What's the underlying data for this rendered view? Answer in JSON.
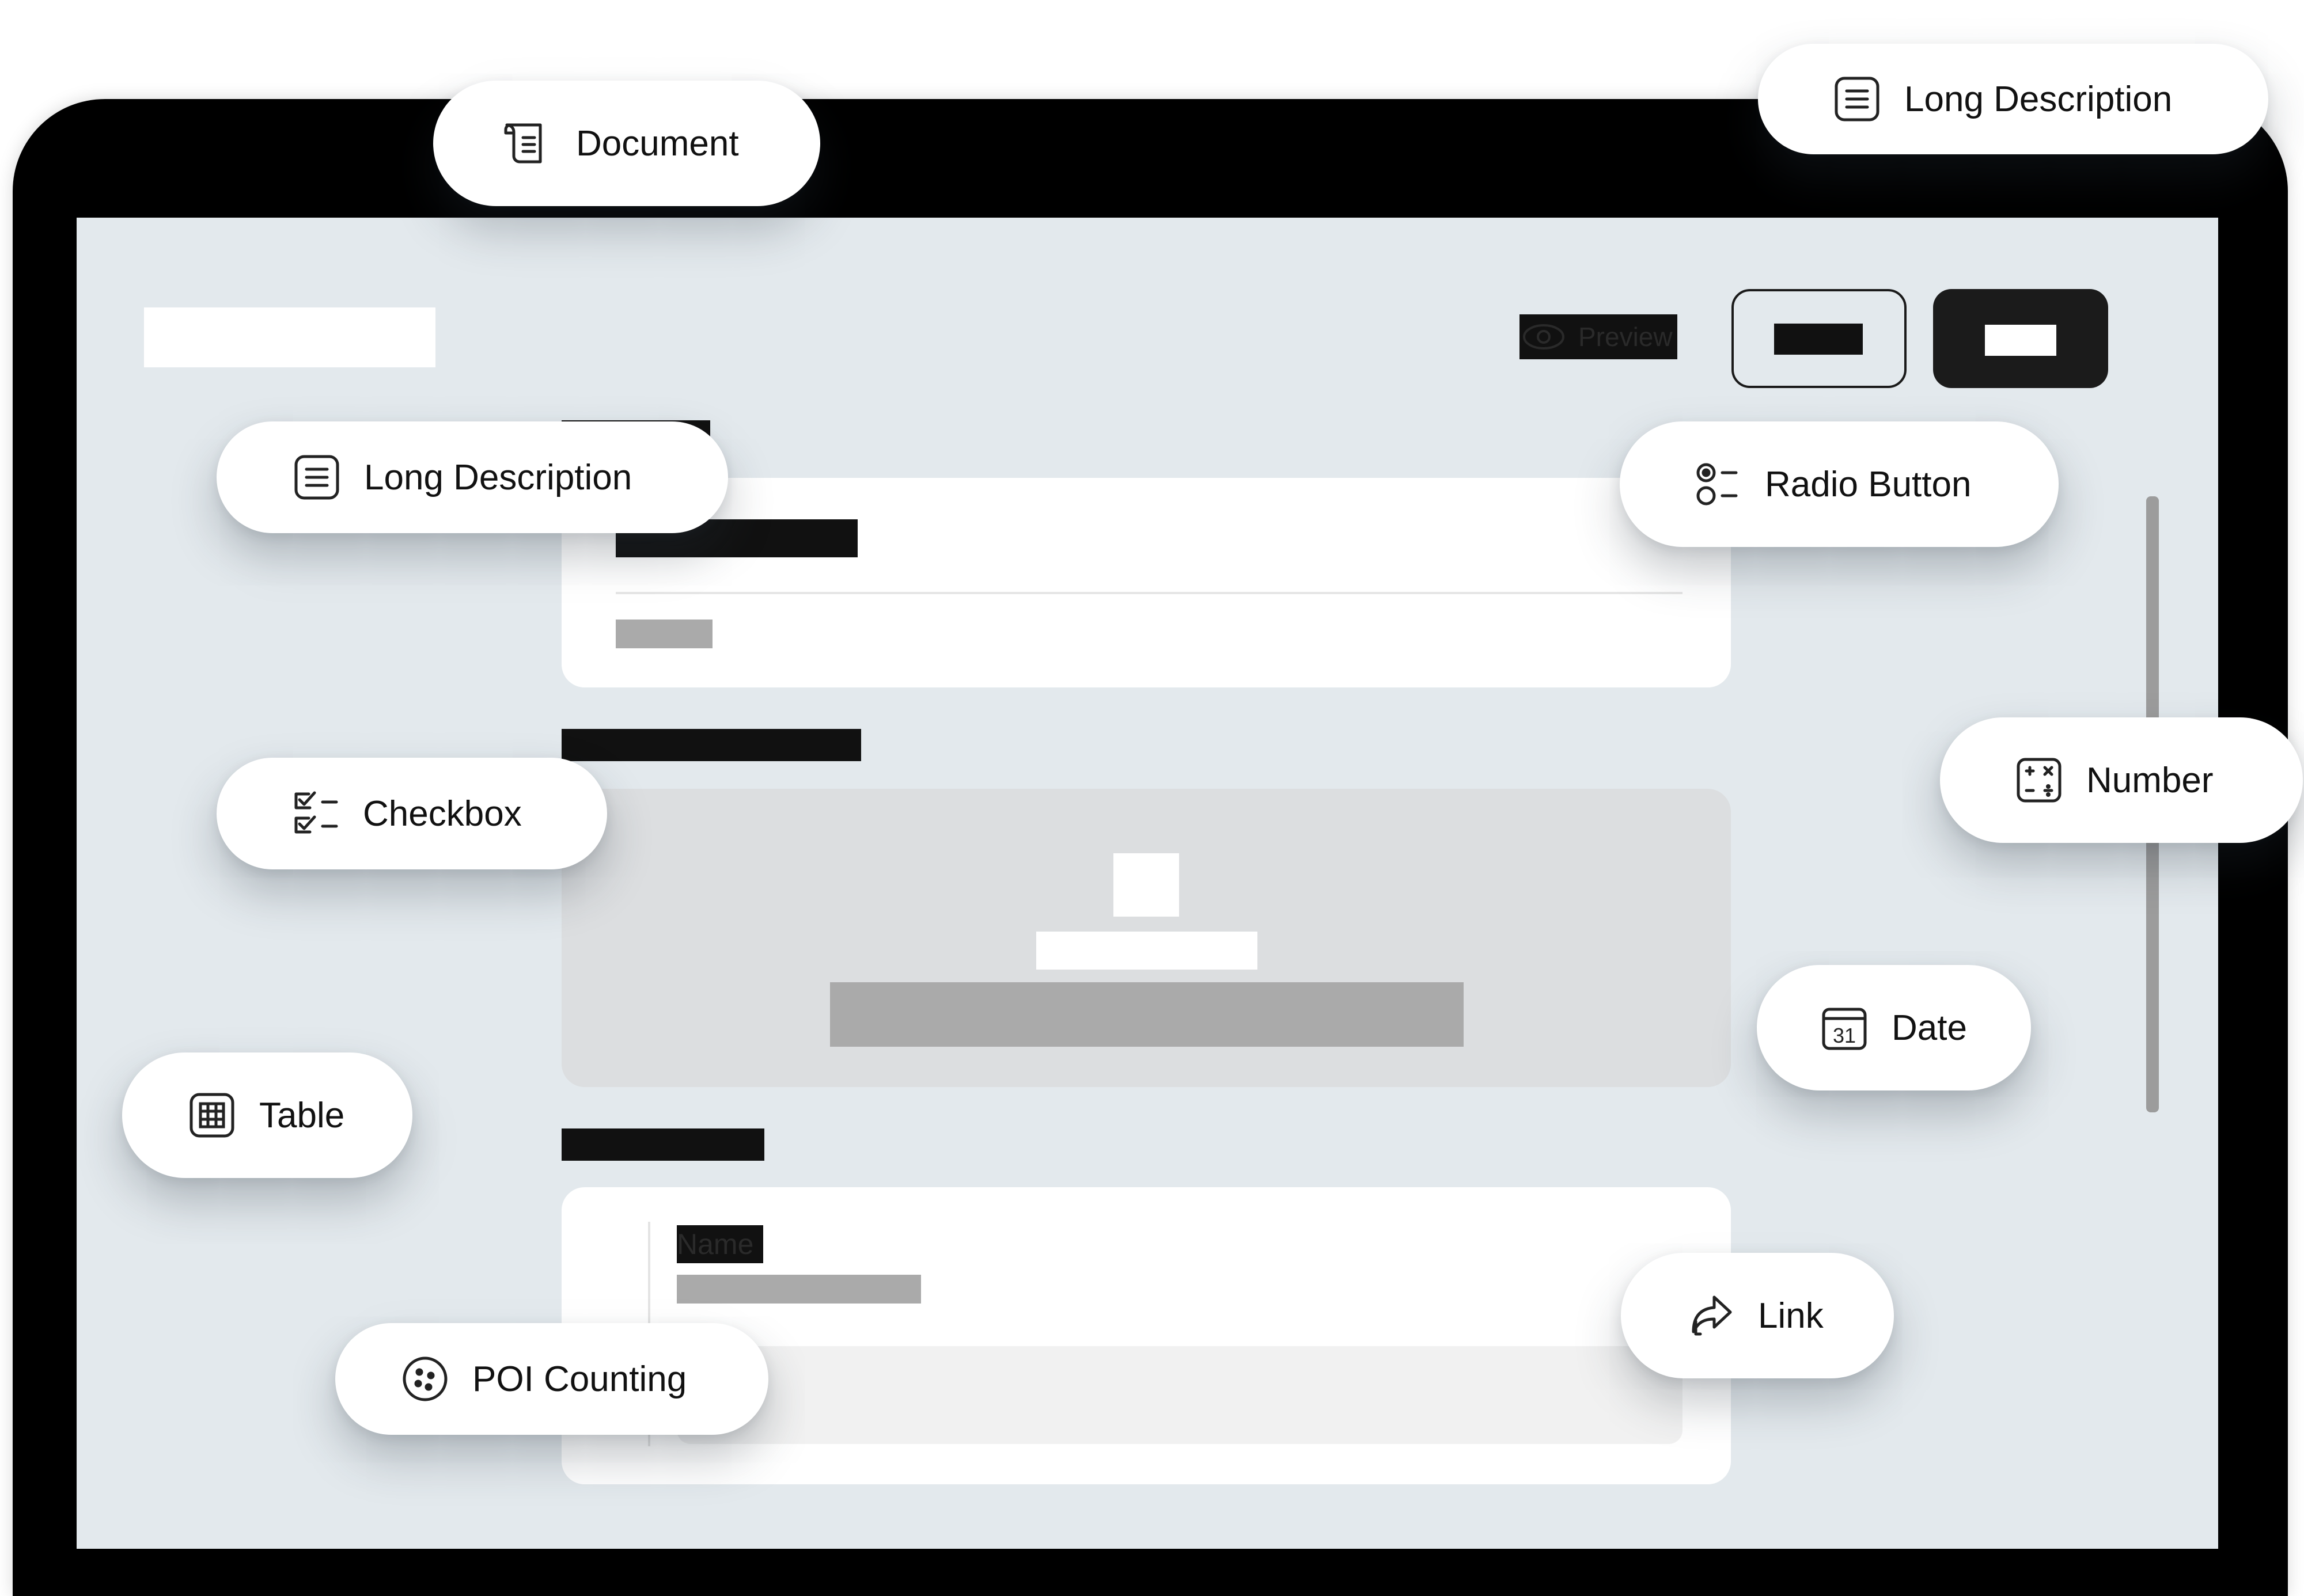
{
  "app": {
    "preview_label": "Preview",
    "table_header": "Name"
  },
  "chips": [
    {
      "name": "document",
      "label": "Document",
      "icon": "document-icon"
    },
    {
      "name": "long-description-top",
      "label": "Long Description",
      "icon": "long-description-icon"
    },
    {
      "name": "long-description-left",
      "label": "Long Description",
      "icon": "long-description-icon"
    },
    {
      "name": "radio-button",
      "label": "Radio Button",
      "icon": "radio-button-icon"
    },
    {
      "name": "checkbox",
      "label": "Checkbox",
      "icon": "checkbox-icon"
    },
    {
      "name": "number",
      "label": "Number",
      "icon": "number-icon"
    },
    {
      "name": "date",
      "label": "Date",
      "icon": "calendar-icon",
      "icon_text": "31"
    },
    {
      "name": "table",
      "label": "Table",
      "icon": "table-icon"
    },
    {
      "name": "link",
      "label": "Link",
      "icon": "link-share-icon"
    },
    {
      "name": "poi-counting",
      "label": "POI Counting",
      "icon": "poi-counting-icon"
    }
  ],
  "colors": {
    "screen_bg": "#e3e9ed",
    "frame": "#000000",
    "primary_button": "#1b1b1b",
    "chip_bg": "#ffffff"
  }
}
